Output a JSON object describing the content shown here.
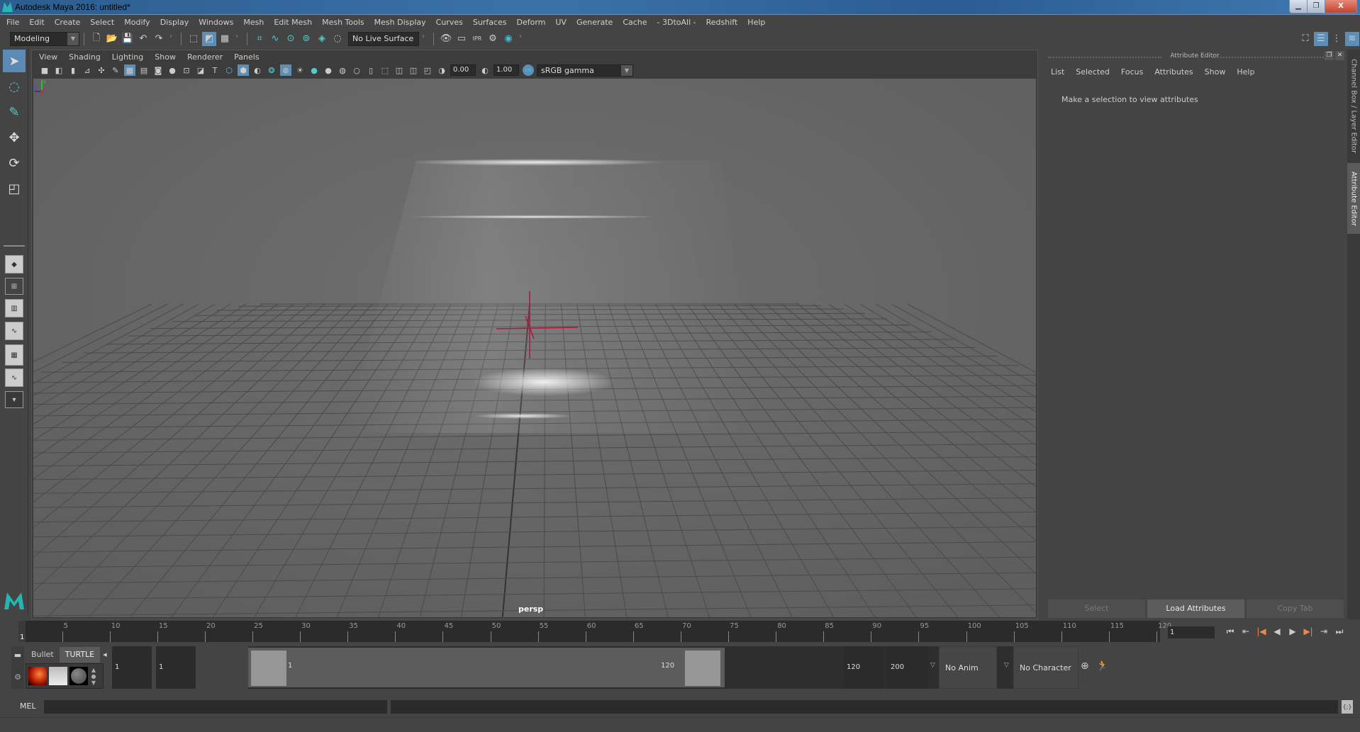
{
  "window": {
    "title": "Autodesk Maya 2016: untitled*",
    "controls": [
      "minimize",
      "restore",
      "close"
    ]
  },
  "menubar": [
    "File",
    "Edit",
    "Create",
    "Select",
    "Modify",
    "Display",
    "Windows",
    "Mesh",
    "Edit Mesh",
    "Mesh Tools",
    "Mesh Display",
    "Curves",
    "Surfaces",
    "Deform",
    "UV",
    "Generate",
    "Cache",
    "- 3DtoAll -",
    "Redshift",
    "Help"
  ],
  "statusline": {
    "workspace": "Modeling",
    "live_surface": "No Live Surface",
    "icons": [
      "new-scene-icon",
      "open-scene-icon",
      "save-scene-icon",
      "undo-icon",
      "redo-icon",
      "select-by-hierarchy-icon",
      "select-by-object-icon",
      "select-by-component-icon",
      "snap-grid-icon",
      "snap-curve-icon",
      "snap-point-icon",
      "snap-view-plane-icon",
      "snap-live-icon",
      "snap-make-live-icon",
      "render-view-icon",
      "render-current-icon",
      "ipr-render-icon",
      "render-settings-icon",
      "hypershade-icon"
    ],
    "right_icons": [
      "modeling-toolkit-icon",
      "attribute-editor-toggle-icon",
      "tool-settings-icon",
      "channel-box-icon"
    ]
  },
  "toolbox": {
    "tools": [
      "select-tool",
      "lasso-tool",
      "paint-select-tool",
      "move-tool",
      "rotate-tool",
      "scale-tool"
    ],
    "layouts": [
      "single-perspective-layout",
      "four-view-layout",
      "persp-outliner-layout",
      "persp-graph-layout",
      "persp-outliner-graph-layout",
      "hypershade-persp-layout"
    ],
    "more": "▾"
  },
  "viewport": {
    "menu": [
      "View",
      "Shading",
      "Lighting",
      "Show",
      "Renderer",
      "Panels"
    ],
    "exposure": "0.00",
    "gamma": "1.00",
    "color_management": "ON",
    "colorspace": "sRGB gamma",
    "camera_label": "persp",
    "axis": {
      "x": "x",
      "y": "y",
      "z": "z"
    }
  },
  "attribute_editor": {
    "title": "Attribute Editor",
    "menu": [
      "List",
      "Selected",
      "Focus",
      "Attributes",
      "Show",
      "Help"
    ],
    "message": "Make a selection to view attributes",
    "buttons": {
      "select": "Select",
      "load": "Load Attributes",
      "copy": "Copy Tab"
    }
  },
  "side_tabs": {
    "channel_box": "Channel Box / Layer Editor",
    "attribute_editor": "Attribute Editor"
  },
  "timeline": {
    "ticks": [
      5,
      10,
      15,
      20,
      25,
      30,
      35,
      40,
      45,
      50,
      55,
      60,
      65,
      70,
      75,
      80,
      85,
      90,
      95,
      100,
      105,
      110,
      115,
      120
    ],
    "start": 1,
    "end": 120,
    "current_frame_label": "1",
    "current_frame_field": "1",
    "playback": [
      "⏮",
      "⇤",
      "|◀",
      "◀",
      "▶",
      "▶|",
      "⇥",
      "⏭"
    ]
  },
  "range": {
    "start_time": "1",
    "playback_start": "1",
    "range_start_label": "1",
    "range_end_label": "120",
    "playback_end": "120",
    "end_time": "200",
    "anim_layer": "No Anim Layer",
    "character_set": "No Character Set"
  },
  "shelf": {
    "tabs": [
      "Bullet",
      "TURTLE"
    ],
    "active": "TURTLE"
  },
  "command_line": {
    "label": "MEL",
    "value": ""
  }
}
